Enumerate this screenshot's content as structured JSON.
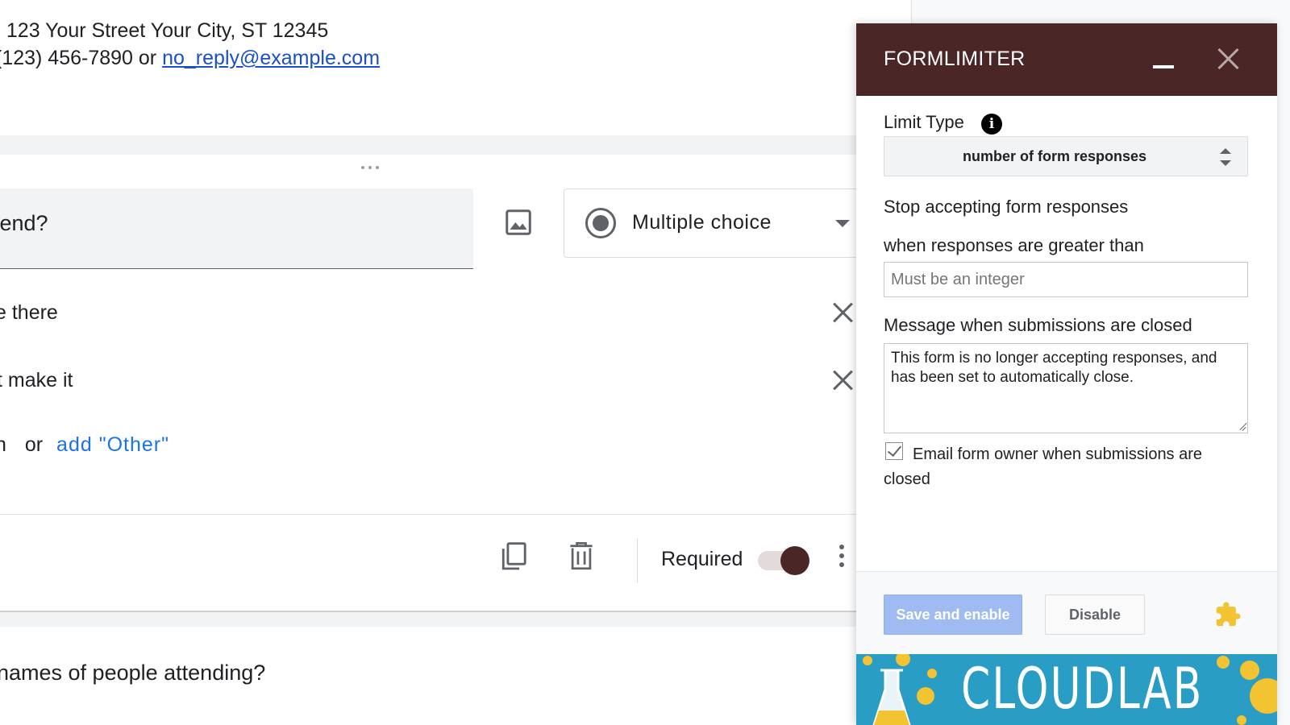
{
  "form": {
    "address_line": ": 123 Your Street Your City, ST 12345",
    "contact_prefix": "(123) 456-7890 or ",
    "contact_email": "no_reply@example.com",
    "question_title": "tend?",
    "question_type": "Multiple choice",
    "options": [
      "e there",
      "t make it"
    ],
    "add_option_prefix": "n",
    "add_option_or": "or",
    "add_other_label": "add \"Other\"",
    "required_label": "Required",
    "required_on": true,
    "next_question": "names of people attending?"
  },
  "panel": {
    "title": "FORMLIMITER",
    "limit_type_label": "Limit Type",
    "limit_type_value": "number of form responses",
    "stop_label": "Stop accepting form responses",
    "threshold_label": "when responses are greater than",
    "threshold_placeholder": "Must be an integer",
    "closed_message_label": "Message when submissions are closed",
    "closed_message": "This form is no longer accepting responses, and has been set to automatically close.",
    "email_owner_label": "Email form owner when submissions are closed",
    "email_owner_checked": true,
    "save_button": "Save and enable",
    "disable_button": "Disable",
    "banner_text": "CLOUDLAB"
  },
  "colors": {
    "panel_header": "#4a2626",
    "save_button": "#9fbbf1",
    "link": "#1a73e8",
    "banner": "#2a9dc4",
    "accent_yellow": "#f3c431"
  },
  "icons": [
    "image-icon",
    "radio-icon",
    "dropdown-arrow-icon",
    "close-option-icon",
    "copy-icon",
    "trash-icon",
    "more-vert-icon",
    "minimize-icon",
    "close-icon",
    "info-icon",
    "updown-icon",
    "puzzle-icon",
    "flask-icon"
  ]
}
